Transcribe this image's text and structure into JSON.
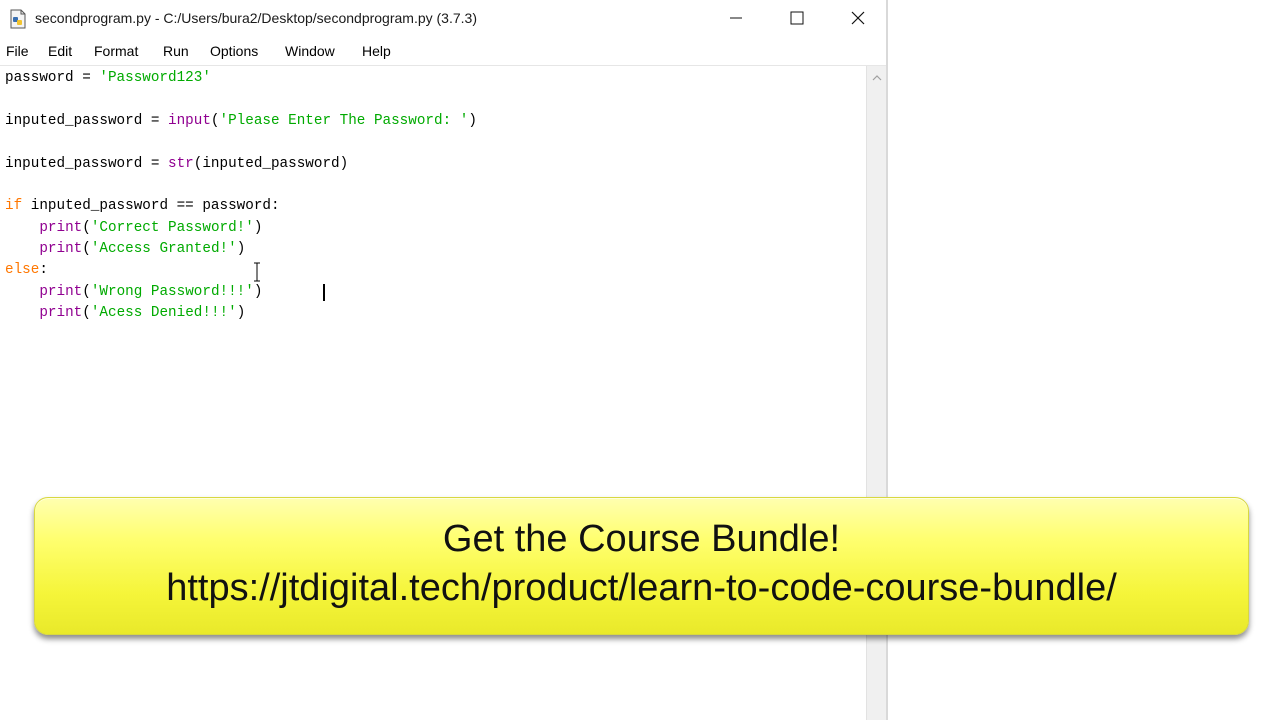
{
  "window": {
    "title": "secondprogram.py - C:/Users/bura2/Desktop/secondprogram.py (3.7.3)",
    "minimize_icon": "minimize-icon",
    "maximize_icon": "maximize-icon",
    "close_icon": "close-icon"
  },
  "menu": {
    "items": [
      "File",
      "Edit",
      "Format",
      "Run",
      "Options",
      "Window",
      "Help"
    ]
  },
  "code": {
    "l1_var": "password = ",
    "l1_str": "'Password123'",
    "l2_var": "inputed_password = ",
    "l2_fn": "input",
    "l2_open": "(",
    "l2_str": "'Please Enter The Password: '",
    "l2_close": ")",
    "l3_var": "inputed_password = ",
    "l3_fn": "str",
    "l3_rest": "(inputed_password)",
    "l4_kw": "if",
    "l4_rest": " inputed_password == password:",
    "l5_indent": "    ",
    "l5_fn": "print",
    "l5_open": "(",
    "l5_str": "'Correct Password!'",
    "l5_close": ")",
    "l6_indent": "    ",
    "l6_fn": "print",
    "l6_open": "(",
    "l6_str": "'Access Granted!'",
    "l6_close": ")",
    "l7_kw": "else",
    "l7_rest": ":",
    "l8_indent": "    ",
    "l8_fn": "print",
    "l8_open": "(",
    "l8_str": "'Wrong Password!!!'",
    "l8_close": ")",
    "l9_indent": "    ",
    "l9_fn": "print",
    "l9_open": "(",
    "l9_str": "'Acess Denied!!!'",
    "l9_close": ")"
  },
  "banner": {
    "line1": "Get the Course Bundle!",
    "line2": "https://jtdigital.tech/product/learn-to-code-course-bundle/"
  },
  "colors": {
    "keyword": "#ff7700",
    "builtin": "#900090",
    "string": "#00aa00",
    "banner": "#f5f53a"
  }
}
